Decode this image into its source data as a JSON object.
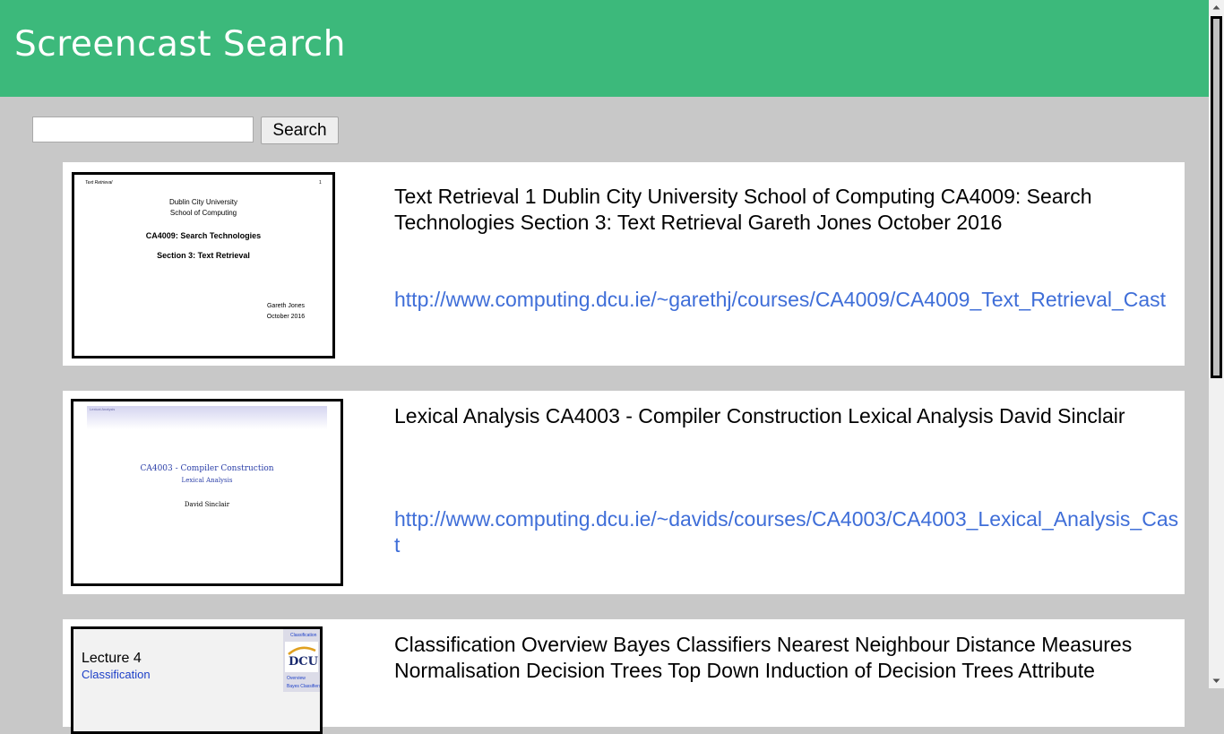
{
  "header": {
    "title": "Screencast Search"
  },
  "search": {
    "value": "",
    "placeholder": "",
    "button_label": "Search"
  },
  "results": [
    {
      "title": "Text Retrieval 1 Dublin City University School of Computing CA4009: Search Technologies Section 3: Text Retrieval Gareth Jones October 2016",
      "link": "http://www.computing.dcu.ie/~garethj/courses/CA4009/CA4009_Text_Retrieval_Cast",
      "thumbnail": {
        "header_left": "Text Retrieval",
        "header_right": "1",
        "line1": "Dublin City University",
        "line2": "School of Computing",
        "line3": "CA4009: Search Technologies",
        "line4": "Section 3: Text Retrieval",
        "author": "Gareth Jones",
        "date": "October 2016"
      }
    },
    {
      "title": "Lexical Analysis CA4003 - Compiler Construction Lexical Analysis David Sinclair",
      "link": "http://www.computing.dcu.ie/~davids/courses/CA4003/CA4003_Lexical_Analysis_Cast",
      "thumbnail": {
        "header_left": "Lexical Analysis",
        "line1": "CA4003 - Compiler Construction",
        "line2": "Lexical Analysis",
        "author": "David Sinclair"
      }
    },
    {
      "title": "Classification Overview Bayes Classifiers Nearest Neighbour Distance Measures Normalisation Decision Trees Top Down Induction of Decision Trees Attribute",
      "link": "",
      "thumbnail": {
        "line1": "Lecture 4",
        "line2": "Classification",
        "nav1": "Classification",
        "logo": "DCU",
        "nav2": "Overview",
        "nav3": "Bayes Classifiers"
      }
    }
  ],
  "colors": {
    "header_bg": "#3cb97b",
    "page_bg": "#c8c8c8",
    "link": "#3f6ed8"
  }
}
